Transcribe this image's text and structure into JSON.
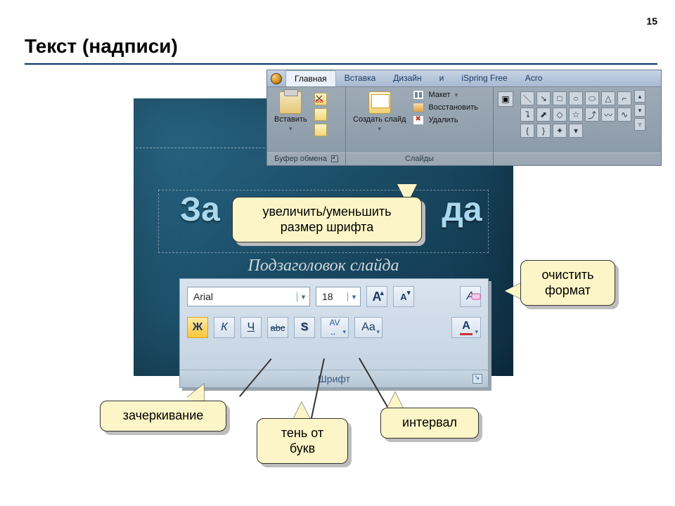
{
  "page_number": "15",
  "title": "Текст (надписи)",
  "slide": {
    "title_fragment_left": "За",
    "title_fragment_right": "да",
    "subtitle": "Подзаголовок слайда"
  },
  "ribbon": {
    "tabs": [
      "Главная",
      "Вставка",
      "Дизайн",
      "и",
      "iSpring Free",
      "Acro"
    ],
    "active_tab": 0,
    "clipboard": {
      "paste": "Вставить",
      "group": "Буфер обмена"
    },
    "slides": {
      "new_slide": "Создать слайд",
      "layout": "Макет",
      "reset": "Восстановить",
      "delete": "Удалить",
      "group": "Слайды"
    },
    "shape_glyphs": [
      "＼",
      "↘",
      "□",
      "○",
      "⬭",
      "△",
      "⌐",
      "⮧",
      "⬈",
      "◇",
      "☆",
      "⤴",
      "〰",
      "∿",
      "{",
      "}",
      "✦",
      "▾"
    ]
  },
  "font_panel": {
    "font_name": "Arial",
    "font_size": "18",
    "group": "Шрифт",
    "btn_bold": "Ж",
    "btn_italic": "К",
    "btn_underline": "Ч",
    "btn_strike": "abc",
    "btn_shadow": "S",
    "btn_spacing": "AV",
    "btn_case": "Aa",
    "btn_color": "A",
    "btn_grow": "A",
    "btn_shrink": "A",
    "btn_clear": "A"
  },
  "callouts": {
    "fontsize": "увеличить/уменьшить размер шрифта",
    "clear": "очистить формат",
    "strike": "зачеркивание",
    "shadow": "тень от букв",
    "spacing": "интервал"
  }
}
